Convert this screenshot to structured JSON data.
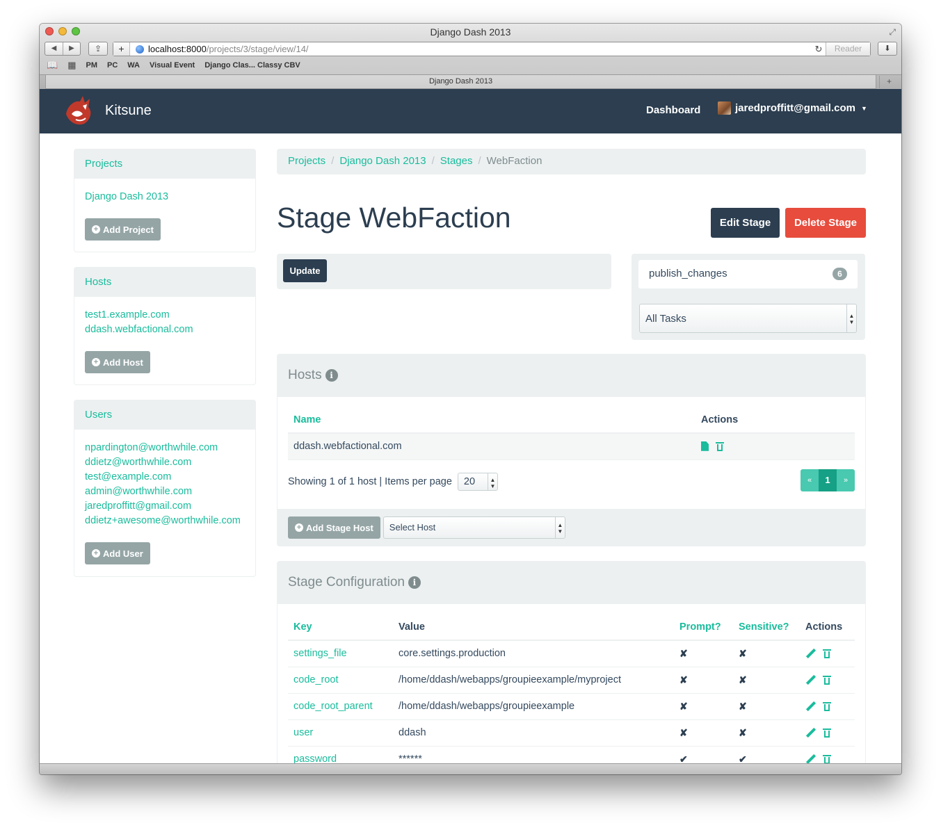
{
  "window": {
    "title": "Django Dash 2013"
  },
  "browser": {
    "url_host": "localhost:8000",
    "url_path": "/projects/3/stage/view/14/",
    "reader_label": "Reader",
    "bookmarks": [
      "PM",
      "PC",
      "WA",
      "Visual Event",
      "Django Clas... Classy CBV"
    ],
    "tab_title": "Django Dash 2013"
  },
  "navbar": {
    "brand": "Kitsune",
    "dashboard_label": "Dashboard",
    "user_email": "jaredproffitt@gmail.com"
  },
  "sidebar": {
    "projects": {
      "heading": "Projects",
      "items": [
        "Django Dash 2013"
      ],
      "add_label": "Add Project"
    },
    "hosts": {
      "heading": "Hosts",
      "items": [
        "test1.example.com",
        "ddash.webfactional.com"
      ],
      "add_label": "Add Host"
    },
    "users": {
      "heading": "Users",
      "items": [
        "npardington@worthwhile.com",
        "ddietz@worthwhile.com",
        "test@example.com",
        "admin@worthwhile.com",
        "jaredproffitt@gmail.com",
        "ddietz+awesome@worthwhile.com"
      ],
      "add_label": "Add User"
    }
  },
  "breadcrumb": [
    "Projects",
    "Django Dash 2013",
    "Stages",
    "WebFaction"
  ],
  "page": {
    "title": "Stage WebFaction",
    "edit_label": "Edit Stage",
    "delete_label": "Delete Stage",
    "update_label": "Update"
  },
  "tasks": {
    "item": "publish_changes",
    "count": "6",
    "filter_value": "All Tasks"
  },
  "hosts_section": {
    "title": "Hosts",
    "columns": [
      "Name",
      "Actions"
    ],
    "rows": [
      {
        "name": "ddash.webfactional.com"
      }
    ],
    "showing_text": "Showing 1 of 1 host | Items per page",
    "per_page": "20",
    "pagination": {
      "prev": "«",
      "current": "1",
      "next": "»"
    },
    "add_label": "Add Stage Host",
    "select_placeholder": "Select Host"
  },
  "config_section": {
    "title": "Stage Configuration",
    "columns": [
      "Key",
      "Value",
      "Prompt?",
      "Sensitive?",
      "Actions"
    ],
    "rows": [
      {
        "key": "settings_file",
        "value": "core.settings.production",
        "prompt": "✘",
        "sensitive": "✘"
      },
      {
        "key": "code_root",
        "value": "/home/ddash/webapps/groupieexample/myproject",
        "prompt": "✘",
        "sensitive": "✘"
      },
      {
        "key": "code_root_parent",
        "value": "/home/ddash/webapps/groupieexample",
        "prompt": "✘",
        "sensitive": "✘"
      },
      {
        "key": "user",
        "value": "ddash",
        "prompt": "✘",
        "sensitive": "✘"
      },
      {
        "key": "password",
        "value": "******",
        "prompt": "✔",
        "sensitive": "✔"
      }
    ]
  },
  "colors": {
    "navbar": "#2c3e50",
    "accent": "#1abc9c",
    "danger": "#e74c3c",
    "muted_button": "#95a5a6",
    "well": "#ecf0f1"
  }
}
